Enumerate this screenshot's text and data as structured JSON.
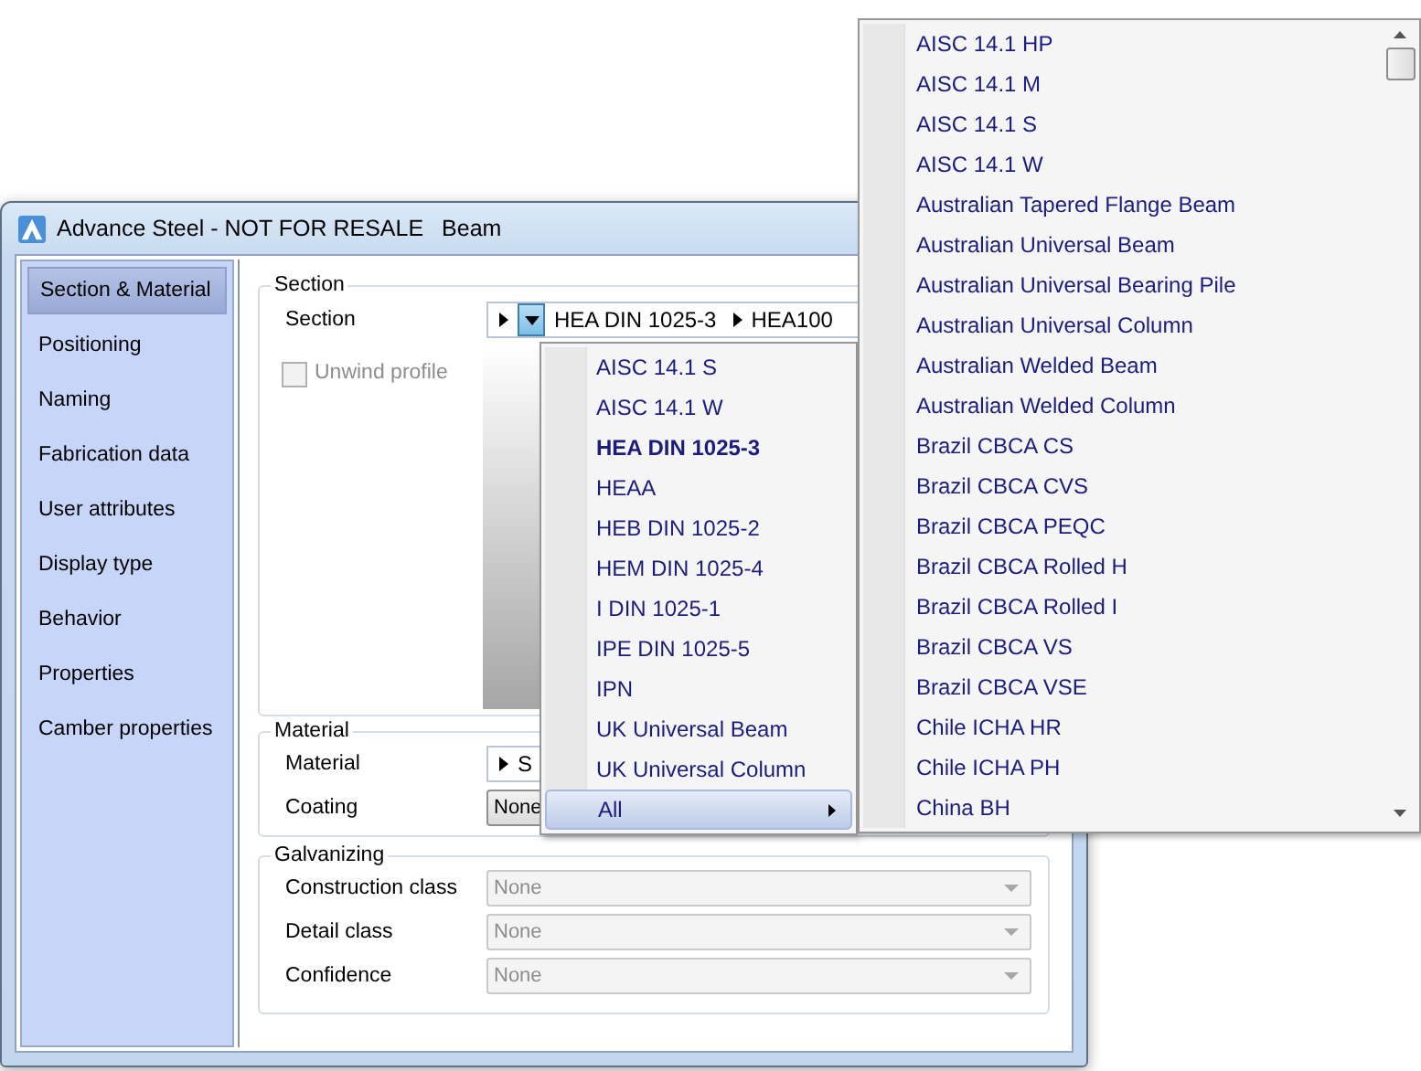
{
  "window": {
    "title": "Advance Steel - NOT FOR RESALE",
    "subtitle": "Beam"
  },
  "sidebar": {
    "items": [
      {
        "label": "Section & Material",
        "selected": true
      },
      {
        "label": "Positioning",
        "selected": false
      },
      {
        "label": "Naming",
        "selected": false
      },
      {
        "label": "Fabrication data",
        "selected": false
      },
      {
        "label": "User attributes",
        "selected": false
      },
      {
        "label": "Display type",
        "selected": false
      },
      {
        "label": "Behavior",
        "selected": false
      },
      {
        "label": "Properties",
        "selected": false
      },
      {
        "label": "Camber properties",
        "selected": false
      }
    ]
  },
  "section": {
    "legend": "Section",
    "label": "Section",
    "family": "HEA DIN 1025-3",
    "profile": "HEA100",
    "unwind": {
      "label": "Unwind profile",
      "checked": false,
      "disabled": true
    }
  },
  "material": {
    "legend": "Material",
    "rows": [
      {
        "label": "Material",
        "value": "S",
        "kind": "path"
      },
      {
        "label": "Coating",
        "value": "None",
        "kind": "combo"
      }
    ]
  },
  "galvanizing": {
    "legend": "Galvanizing",
    "rows": [
      {
        "label": "Construction class",
        "value": "None",
        "disabled": true
      },
      {
        "label": "Detail class",
        "value": "None",
        "disabled": true
      },
      {
        "label": "Confidence",
        "value": "None",
        "disabled": true
      }
    ]
  },
  "family_menu": {
    "items": [
      {
        "label": "AISC 14.1 S",
        "kind": "item",
        "selected": false,
        "highlighted": false
      },
      {
        "label": "AISC 14.1 W",
        "kind": "item",
        "selected": false,
        "highlighted": false
      },
      {
        "label": "HEA DIN 1025-3",
        "kind": "item",
        "selected": true,
        "highlighted": false
      },
      {
        "label": "HEAA",
        "kind": "item",
        "selected": false,
        "highlighted": false
      },
      {
        "label": "HEB DIN 1025-2",
        "kind": "item",
        "selected": false,
        "highlighted": false
      },
      {
        "label": "HEM DIN 1025-4",
        "kind": "item",
        "selected": false,
        "highlighted": false
      },
      {
        "label": "I DIN 1025-1",
        "kind": "item",
        "selected": false,
        "highlighted": false
      },
      {
        "label": "IPE DIN 1025-5",
        "kind": "item",
        "selected": false,
        "highlighted": false
      },
      {
        "label": "IPN",
        "kind": "item",
        "selected": false,
        "highlighted": false
      },
      {
        "label": "UK Universal Beam",
        "kind": "item",
        "selected": false,
        "highlighted": false
      },
      {
        "label": "UK Universal Column",
        "kind": "item",
        "selected": false,
        "highlighted": false
      },
      {
        "label": "All",
        "kind": "submenu",
        "selected": false,
        "highlighted": true
      }
    ]
  },
  "all_menu": {
    "items": [
      "AISC 14.1 HP",
      "AISC 14.1 M",
      "AISC 14.1 S",
      "AISC 14.1 W",
      "Australian Tapered Flange Beam",
      "Australian Universal Beam",
      "Australian Universal Bearing Pile",
      "Australian Universal Column",
      "Australian Welded Beam",
      "Australian Welded Column",
      "Brazil CBCA CS",
      "Brazil CBCA CVS",
      "Brazil CBCA PEQC",
      "Brazil CBCA Rolled H",
      "Brazil CBCA Rolled I",
      "Brazil CBCA VS",
      "Brazil CBCA VSE",
      "Chile ICHA HR",
      "Chile ICHA PH",
      "China BH"
    ]
  }
}
